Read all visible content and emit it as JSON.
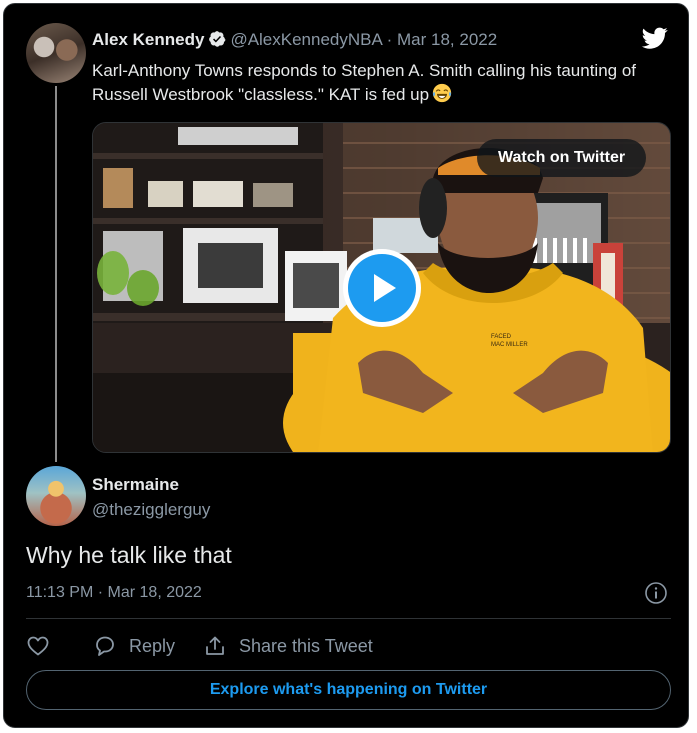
{
  "tweet": {
    "author_name": "Alex Kennedy",
    "author_handle": "@AlexKennedyNBA",
    "separator": " · ",
    "date": "Mar 18, 2022",
    "text": "Karl-Anthony Towns responds to Stephen A. Smith calling his taunting of Russell Westbrook \"classless.\" KAT is fed up",
    "emoji": "face-with-tears-of-joy",
    "video": {
      "watch_label": "Watch on Twitter"
    }
  },
  "reply": {
    "author_name": "Shermaine",
    "author_handle": "@thezigglerguy",
    "text": "Why he talk like that",
    "timestamp": "11:13 PM · Mar 18, 2022"
  },
  "actions": {
    "like_label": "",
    "reply_label": "Reply",
    "share_label": "Share this Tweet"
  },
  "footer": {
    "explore_label": "Explore what's happening on Twitter"
  },
  "colors": {
    "background": "#000000",
    "text": "#e7e9ea",
    "muted": "#8b98a5",
    "accent": "#1d9bf0",
    "border": "#2f3336"
  },
  "icons": {
    "brand": "twitter-bird-icon",
    "verified": "verified-badge-icon",
    "play": "play-icon",
    "info": "info-icon",
    "like": "heart-icon",
    "reply": "reply-bubble-icon",
    "share": "share-icon"
  }
}
